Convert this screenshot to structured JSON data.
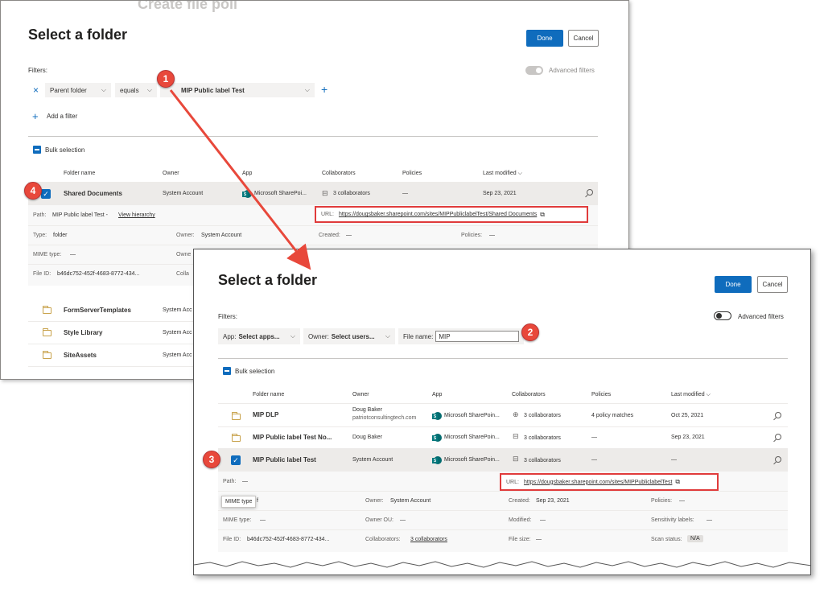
{
  "back": {
    "title": "Select a folder",
    "done_label": "Done",
    "cancel_label": "Cancel",
    "filters_label": "Filters:",
    "advanced_filters_label": "Advanced filters",
    "filter": {
      "remove": "×",
      "field": "Parent folder",
      "operator": "equals",
      "value": "MIP Public label Test",
      "add_plus": "+"
    },
    "add_filter_label": "Add a filter",
    "add_filter_plus": "+",
    "bulk_label": "Bulk selection",
    "columns": [
      "Folder name",
      "Owner",
      "App",
      "Collaborators",
      "Policies",
      "Last modified ⌵"
    ],
    "selected_row": {
      "name": "Shared Documents",
      "owner": "System Account",
      "app": "Microsoft SharePoi...",
      "collaborators": "3 collaborators",
      "policies": "—",
      "modified": "Sep 23, 2021"
    },
    "details": {
      "path_label": "Path:",
      "path_value": "MIP Public label Test -",
      "view_hierarchy": "View hierarchy",
      "url_label": "URL:",
      "url_value": "https://dougsbaker.sharepoint.com/sites/MIPPubliclabelTest/Shared Documents",
      "type_label": "Type:",
      "type_value": "folder",
      "owner_label": "Owner:",
      "owner_value": "System Account",
      "created_label": "Created:",
      "created_value": "—",
      "policies_label": "Policies:",
      "policies_value": "—",
      "mime_label": "MIME type:",
      "mime_value": "—",
      "owner_ou_label": "Owne",
      "fileid_label": "File ID:",
      "fileid_value": "b46dc752-452f-4683-8772-434...",
      "collab_label": "Colla"
    },
    "rows": [
      {
        "name": "FormServerTemplates",
        "owner": "System Acc"
      },
      {
        "name": "Style Library",
        "owner": "System Acc"
      },
      {
        "name": "SiteAssets",
        "owner": "System Acc"
      }
    ],
    "bg_title_fragment": "Create file poli"
  },
  "front": {
    "title": "Select a folder",
    "done_label": "Done",
    "cancel_label": "Cancel",
    "filters_label": "Filters:",
    "advanced_filters_label": "Advanced filters",
    "app_filter_key": "App:",
    "app_filter_value": "Select apps...",
    "owner_filter_key": "Owner:",
    "owner_filter_value": "Select users...",
    "filename_label": "File name:",
    "filename_value": "MIP",
    "bulk_label": "Bulk selection",
    "columns": [
      "Folder name",
      "Owner",
      "App",
      "Collaborators",
      "Policies",
      "Last modified ⌵"
    ],
    "rows": [
      {
        "name": "MIP DLP",
        "owner": "Doug Baker",
        "owner_sub": "patriotconsultingtech.com",
        "app": "Microsoft SharePoin...",
        "collaborators": "3 collaborators",
        "policies": "4 policy matches",
        "modified": "Oct 25, 2021"
      },
      {
        "name": "MIP Public label Test No...",
        "owner": "Doug Baker",
        "owner_sub": "",
        "app": "Microsoft SharePoin...",
        "collaborators": "3 collaborators",
        "policies": "—",
        "modified": "Sep 23, 2021"
      },
      {
        "name": "MIP Public label Test",
        "owner": "System Account",
        "owner_sub": "",
        "app": "Microsoft SharePoin...",
        "collaborators": "3 collaborators",
        "policies": "—",
        "modified": "—"
      }
    ],
    "details": {
      "path_label": "Path:",
      "path_value": "—",
      "url_label": "URL:",
      "url_value": "https://dougsbaker.sharepoint.com/sites/MIPPubliclabelTest",
      "type_fragment": "f",
      "owner_label": "Owner:",
      "owner_value": "System Account",
      "created_label": "Created:",
      "created_value": "Sep 23, 2021",
      "policies_label": "Policies:",
      "policies_value": "—",
      "mime_label": "MIME type:",
      "mime_value": "—",
      "owner_ou_label": "Owner OU:",
      "owner_ou_value": "—",
      "modified_label": "Modified:",
      "modified_value": "—",
      "sens_label": "Sensitivity labels:",
      "sens_value": "—",
      "fileid_label": "File ID:",
      "fileid_value": "b46dc752-452f-4683-8772-434...",
      "collab_label": "Collaborators:",
      "collab_value": "3 collaborators",
      "filesize_label": "File size:",
      "filesize_value": "—",
      "scan_label": "Scan status:",
      "scan_value": "N/A"
    },
    "tooltip": "MIME type"
  },
  "callouts": [
    "1",
    "2",
    "3",
    "4"
  ],
  "colors": {
    "primary": "#0f6cbd",
    "callout": "#e8483b",
    "highlight": "#e03b3b"
  }
}
